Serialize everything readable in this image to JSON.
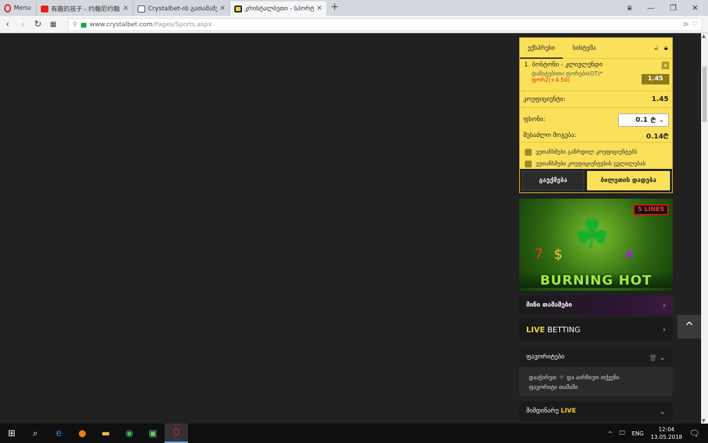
{
  "browser": {
    "menu_label": "Menu",
    "tabs": [
      {
        "title": "有趣的孩子 - 约翰尼约翰尼",
        "favicon_color": "#e62117"
      },
      {
        "title": "Crystalbet-ის გათამაშებ",
        "favicon_color": "#1a4a8a"
      },
      {
        "title": "კრისტალბეთი - სპორტ",
        "favicon_color": "#f5d13b"
      }
    ],
    "url_domain": "www.crystalbet.com",
    "url_path": "/Pages/Sports.aspx"
  },
  "betslip": {
    "tab_express": "ექსპრესი",
    "tab_system": "სისტემა",
    "selection": {
      "index": "1.",
      "match": "ბოსტონი - კლივლენდი",
      "market": "დამატებითი ფორები(OT)*",
      "outcome": "ფორ2(+4.50)",
      "odds": "1.45"
    },
    "coef_label": "კოეფიციენტი:",
    "coef_value": "1.45",
    "stake_label": "ფსონი:",
    "stake_value": "0.1",
    "currency": "₾",
    "win_label": "შესაძლო მოგება:",
    "win_value": "0.14₾",
    "check1": "ვეთანხმები გაზრდილ კოეფიციენტებს",
    "check2": "ვეთანხმები კოეფიციენტების ცვლილებას",
    "cancel": "გაუქმება",
    "place": "ბილეთის დადება"
  },
  "banner": {
    "badge": "5 LINES",
    "title": "BURNING HOT"
  },
  "mini_games": "მინი თამაშები",
  "live_betting": {
    "live": "LIVE",
    "betting": "BETTING"
  },
  "favorites": {
    "title": "ფავორიტები",
    "text1": "დააჭირეთ",
    "text2": "და აირჩიეთ თქვენი",
    "text3": "ფავორიტი თამაში"
  },
  "current_live": {
    "prefix": "მიმდინარე",
    "live": "LIVE"
  },
  "taskbar": {
    "lang": "ENG",
    "time": "12:04",
    "date": "13.05.2018"
  }
}
